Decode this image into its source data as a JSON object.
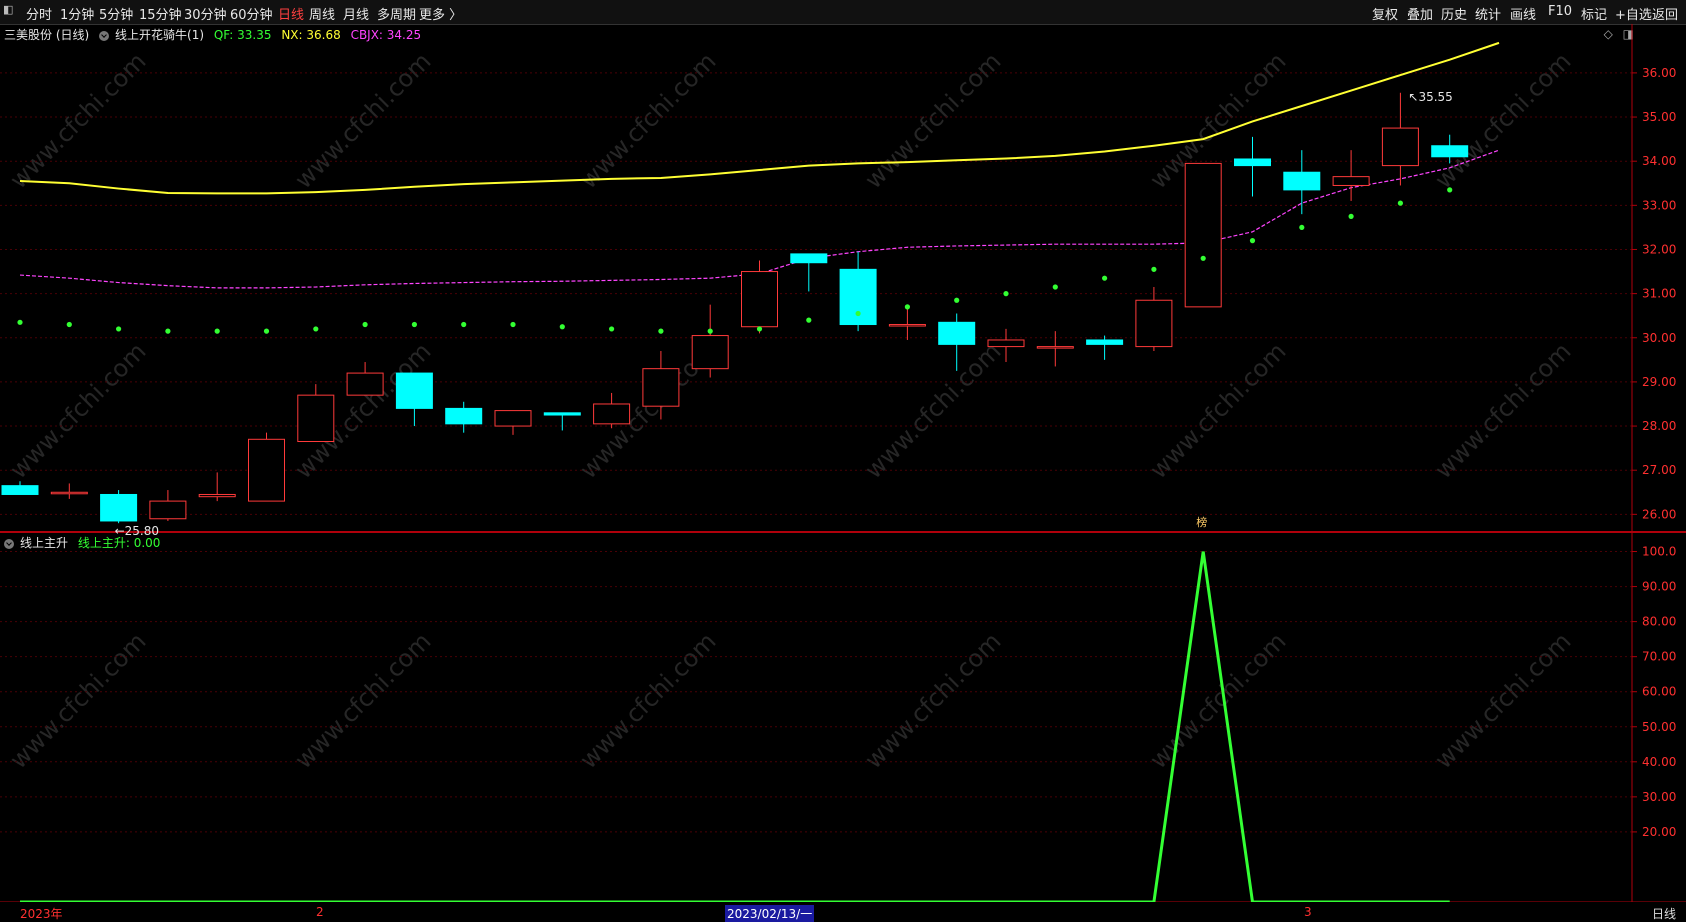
{
  "toolbar": {
    "left_items": [
      "分时",
      "1分钟",
      "5分钟",
      "15分钟",
      "30分钟",
      "60分钟",
      "日线",
      "周线",
      "月线",
      "多周期",
      "更多 〉"
    ],
    "active_item": "日线",
    "right_items": [
      "复权",
      "叠加",
      "历史",
      "统计",
      "画线",
      "F10",
      "标记",
      "+自选",
      "返回"
    ]
  },
  "main_header": {
    "title": "三美股份 (日线)",
    "indicator_name": "线上开花骑牛(1)",
    "qf_label": "QF: 33.35",
    "nx_label": "NX: 36.68",
    "cbjx_label": "CBJX: 34.25"
  },
  "sub_header": {
    "indicator_name": "线上主升",
    "value_label": "线上主升: 0.00"
  },
  "bottom": {
    "year_label": "2023年",
    "month2_label": "2",
    "cursor_date": "2023/02/13/一",
    "month3_label": "3",
    "period": "日线"
  },
  "marker_label": "榜",
  "watermark": "www.cfchi.com",
  "colors": {
    "up": "#ff3a3a",
    "down": "#00ffff",
    "nx_line": "#ffff33",
    "cbjx_line": "#ff44ff",
    "qf_dots": "#33ff33",
    "sub_line": "#33ff33",
    "axis": "#b0000b",
    "axis_text": "#ff3030"
  },
  "chart_data": [
    {
      "type": "candlestick",
      "title": "三美股份 (日线)",
      "ylim": [
        25.6,
        36.7
      ],
      "y_ticks": [
        26.0,
        27.0,
        28.0,
        29.0,
        30.0,
        31.0,
        32.0,
        33.0,
        34.0,
        35.0,
        36.0
      ],
      "y_tick_labels": [
        "26.00",
        "27.00",
        "28.00",
        "29.00",
        "30.00",
        "31.00",
        "32.00",
        "33.00",
        "34.00",
        "35.00",
        "36.00"
      ],
      "candles": [
        {
          "o": 26.65,
          "h": 26.75,
          "l": 26.45,
          "c": 26.45
        },
        {
          "o": 26.5,
          "h": 26.7,
          "l": 26.35,
          "c": 26.5
        },
        {
          "o": 26.45,
          "h": 26.55,
          "l": 25.8,
          "c": 25.85
        },
        {
          "o": 25.9,
          "h": 26.55,
          "l": 25.85,
          "c": 26.3
        },
        {
          "o": 26.4,
          "h": 26.95,
          "l": 26.3,
          "c": 26.45
        },
        {
          "o": 26.3,
          "h": 27.85,
          "l": 26.3,
          "c": 27.7
        },
        {
          "o": 27.65,
          "h": 28.95,
          "l": 27.65,
          "c": 28.7
        },
        {
          "o": 28.7,
          "h": 29.45,
          "l": 28.7,
          "c": 29.2
        },
        {
          "o": 29.2,
          "h": 29.2,
          "l": 28.0,
          "c": 28.4
        },
        {
          "o": 28.4,
          "h": 28.55,
          "l": 27.85,
          "c": 28.05
        },
        {
          "o": 28.0,
          "h": 28.35,
          "l": 27.8,
          "c": 28.35
        },
        {
          "o": 28.3,
          "h": 28.3,
          "l": 27.9,
          "c": 28.25
        },
        {
          "o": 28.05,
          "h": 28.75,
          "l": 27.95,
          "c": 28.5
        },
        {
          "o": 28.45,
          "h": 29.7,
          "l": 28.15,
          "c": 29.3
        },
        {
          "o": 29.3,
          "h": 30.75,
          "l": 29.1,
          "c": 30.05
        },
        {
          "o": 30.25,
          "h": 31.75,
          "l": 30.1,
          "c": 31.5
        },
        {
          "o": 31.9,
          "h": 31.9,
          "l": 31.05,
          "c": 31.7
        },
        {
          "o": 31.55,
          "h": 31.95,
          "l": 30.15,
          "c": 30.3
        },
        {
          "o": 30.3,
          "h": 30.7,
          "l": 29.95,
          "c": 30.3
        },
        {
          "o": 30.35,
          "h": 30.55,
          "l": 29.25,
          "c": 29.85
        },
        {
          "o": 29.8,
          "h": 30.2,
          "l": 29.45,
          "c": 29.95
        },
        {
          "o": 29.8,
          "h": 30.15,
          "l": 29.35,
          "c": 29.8
        },
        {
          "o": 29.95,
          "h": 30.05,
          "l": 29.5,
          "c": 29.85
        },
        {
          "o": 29.8,
          "h": 31.15,
          "l": 29.7,
          "c": 30.85
        },
        {
          "o": 30.7,
          "h": 33.95,
          "l": 30.7,
          "c": 33.95
        },
        {
          "o": 34.05,
          "h": 34.55,
          "l": 33.2,
          "c": 33.9
        },
        {
          "o": 33.75,
          "h": 34.25,
          "l": 32.8,
          "c": 33.35
        },
        {
          "o": 33.45,
          "h": 34.25,
          "l": 33.1,
          "c": 33.65
        },
        {
          "o": 33.9,
          "h": 35.55,
          "l": 33.45,
          "c": 34.75
        },
        {
          "o": 34.35,
          "h": 34.6,
          "l": 33.95,
          "c": 34.1
        }
      ],
      "qf": [
        30.35,
        30.3,
        30.2,
        30.15,
        30.15,
        30.15,
        30.2,
        30.3,
        30.3,
        30.3,
        30.3,
        30.25,
        30.2,
        30.15,
        30.15,
        30.2,
        30.4,
        30.55,
        30.7,
        30.85,
        31.0,
        31.15,
        31.35,
        31.55,
        31.8,
        32.2,
        32.5,
        32.75,
        33.05,
        33.35
      ],
      "nx": [
        33.55,
        33.5,
        33.38,
        33.28,
        33.27,
        33.27,
        33.3,
        33.35,
        33.42,
        33.48,
        33.52,
        33.56,
        33.6,
        33.62,
        33.7,
        33.8,
        33.9,
        33.95,
        33.98,
        34.02,
        34.06,
        34.12,
        34.22,
        34.35,
        34.5,
        34.9,
        35.25,
        35.6,
        35.95,
        36.3,
        36.68
      ],
      "cbjx": [
        31.42,
        31.35,
        31.25,
        31.18,
        31.13,
        31.13,
        31.15,
        31.2,
        31.23,
        31.25,
        31.27,
        31.28,
        31.3,
        31.32,
        31.35,
        31.45,
        31.8,
        31.95,
        32.05,
        32.08,
        32.1,
        32.12,
        32.12,
        32.12,
        32.15,
        32.4,
        33.05,
        33.4,
        33.6,
        33.85,
        34.25
      ],
      "annotations": [
        {
          "label": "25.80",
          "candle": 2,
          "value": 25.8
        },
        {
          "label": "35.55",
          "candle": 28,
          "value": 35.55
        }
      ]
    },
    {
      "type": "line",
      "title": "线上主升",
      "ylim": [
        0,
        105
      ],
      "y_ticks": [
        20,
        30,
        40,
        50,
        60,
        70,
        80,
        90,
        100
      ],
      "y_tick_labels": [
        "20.00",
        "30.00",
        "40.00",
        "50.00",
        "60.00",
        "70.00",
        "80.00",
        "90.00",
        "100.0"
      ],
      "values": [
        0,
        0,
        0,
        0,
        0,
        0,
        0,
        0,
        0,
        0,
        0,
        0,
        0,
        0,
        0,
        0,
        0,
        0,
        0,
        0,
        0,
        0,
        0,
        0,
        100,
        0,
        0,
        0,
        0,
        0
      ]
    }
  ]
}
